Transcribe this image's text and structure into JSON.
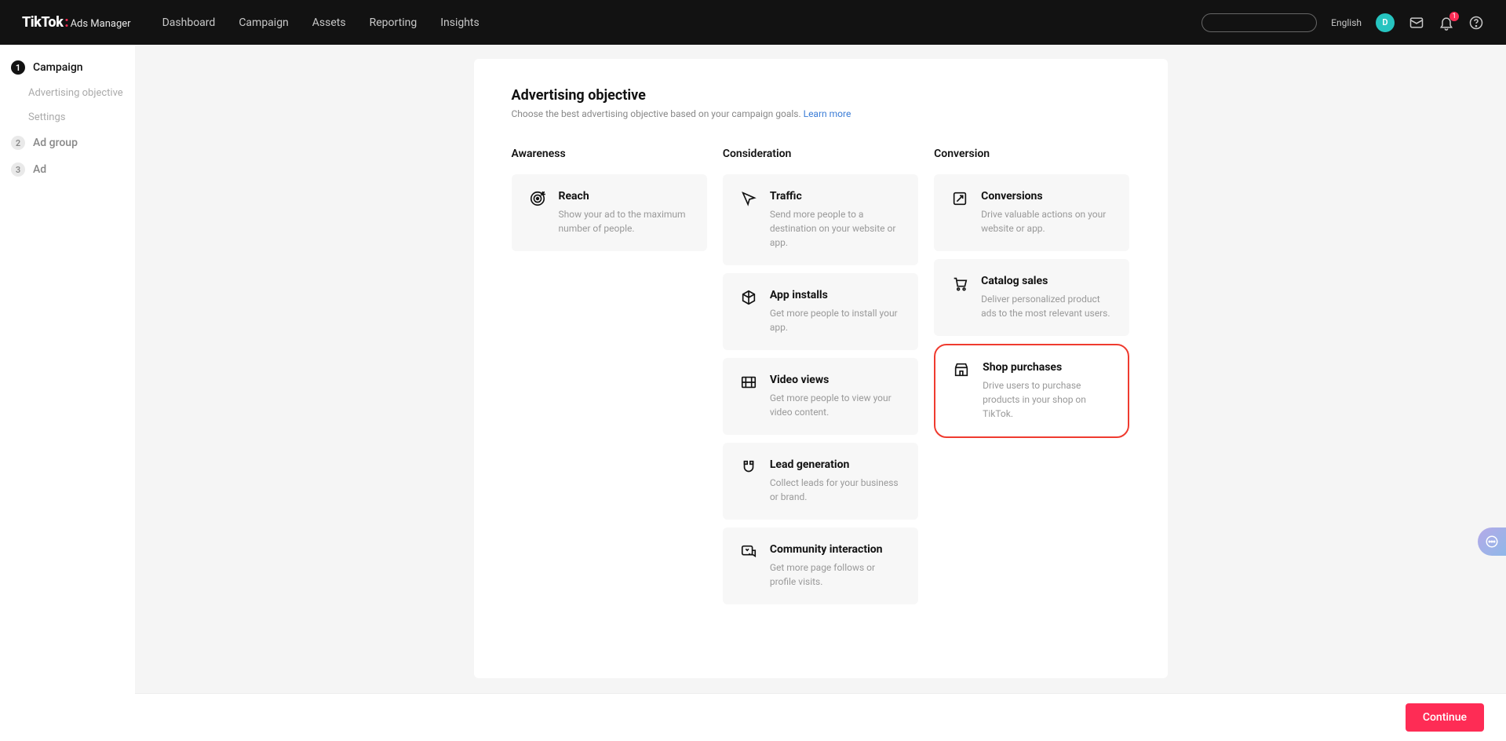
{
  "topbar": {
    "logo_main": "TikTok",
    "logo_sub": "Ads Manager",
    "nav": [
      "Dashboard",
      "Campaign",
      "Assets",
      "Reporting",
      "Insights"
    ],
    "language": "English",
    "avatar_letter": "D",
    "notif_badge": "1"
  },
  "sidebar": {
    "steps": [
      {
        "num": "1",
        "label": "Campaign",
        "active": true
      },
      {
        "num": "2",
        "label": "Ad group",
        "active": false
      },
      {
        "num": "3",
        "label": "Ad",
        "active": false
      }
    ],
    "subs": [
      "Advertising objective",
      "Settings"
    ]
  },
  "panel": {
    "title": "Advertising objective",
    "desc_prefix": "Choose the best advertising objective based on your campaign goals. ",
    "learn_more": "Learn more"
  },
  "columns": {
    "awareness": {
      "head": "Awareness",
      "cards": [
        {
          "title": "Reach",
          "desc": "Show your ad to the maximum number of people."
        }
      ]
    },
    "consideration": {
      "head": "Consideration",
      "cards": [
        {
          "title": "Traffic",
          "desc": "Send more people to a destination on your website or app."
        },
        {
          "title": "App installs",
          "desc": "Get more people to install your app."
        },
        {
          "title": "Video views",
          "desc": "Get more people to view your video content."
        },
        {
          "title": "Lead generation",
          "desc": "Collect leads for your business or brand."
        },
        {
          "title": "Community interaction",
          "desc": "Get more page follows or profile visits."
        }
      ]
    },
    "conversion": {
      "head": "Conversion",
      "cards": [
        {
          "title": "Conversions",
          "desc": "Drive valuable actions on your website or app."
        },
        {
          "title": "Catalog sales",
          "desc": "Deliver personalized product ads to the most relevant users."
        },
        {
          "title": "Shop purchases",
          "desc": "Drive users to purchase products in your shop on TikTok.",
          "highlight": true
        }
      ]
    }
  },
  "footer": {
    "continue": "Continue"
  }
}
